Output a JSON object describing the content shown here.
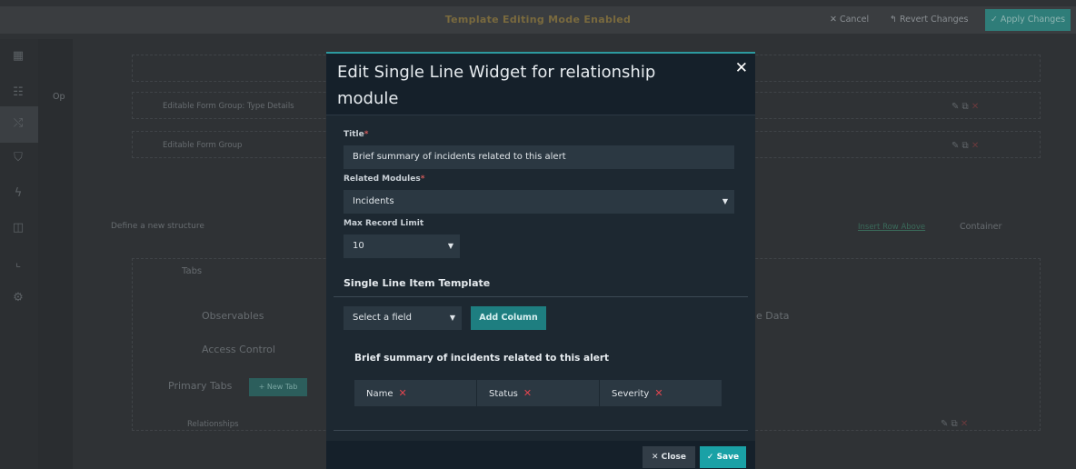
{
  "topbar": {
    "title": "Template Editing Mode Enabled",
    "cancel_label": "✕ Cancel",
    "revert_label": "↰ Revert Changes",
    "apply_label": "✓ Apply Changes"
  },
  "sidebar": {
    "icons": [
      "dashboard-icon",
      "list-icon",
      "shuffle-icon",
      "shield-icon",
      "bolt-icon",
      "briefcase-icon",
      "chart-icon",
      "gear-icon"
    ]
  },
  "background": {
    "op_label": "Op",
    "rows": [
      {
        "label": "Editable Form Group"
      },
      {
        "label": "Editable Form Group: Type Details"
      },
      {
        "label": "Editable Form Group"
      }
    ],
    "define_label": "Define a new structure",
    "insert_label": "Insert Row Above",
    "container_label": "Container",
    "tabs_label": "Tabs",
    "observables_label": "Observables",
    "access_control_label": "Access Control",
    "primary_tabs_label": "Primary Tabs",
    "new_tab_label": "+ New Tab",
    "relationships_label": "Relationships",
    "data_label": "e Data"
  },
  "modal": {
    "title": "Edit Single Line Widget for relationship module",
    "close_icon": "✕",
    "title_field": {
      "label": "Title",
      "value": "Brief summary of incidents related to this alert"
    },
    "related_modules": {
      "label": "Related Modules",
      "value": "Incidents"
    },
    "max_record_limit": {
      "label": "Max Record Limit",
      "value": "10"
    },
    "template_section_title": "Single Line Item Template",
    "select_field_label": "Select a field",
    "add_column_label": "Add Column",
    "preview_title": "Brief summary of incidents related to this alert",
    "columns": [
      "Name",
      "Status",
      "Severity"
    ],
    "footer": {
      "close_label": "✕ Close",
      "save_label": "✓ Save"
    }
  }
}
